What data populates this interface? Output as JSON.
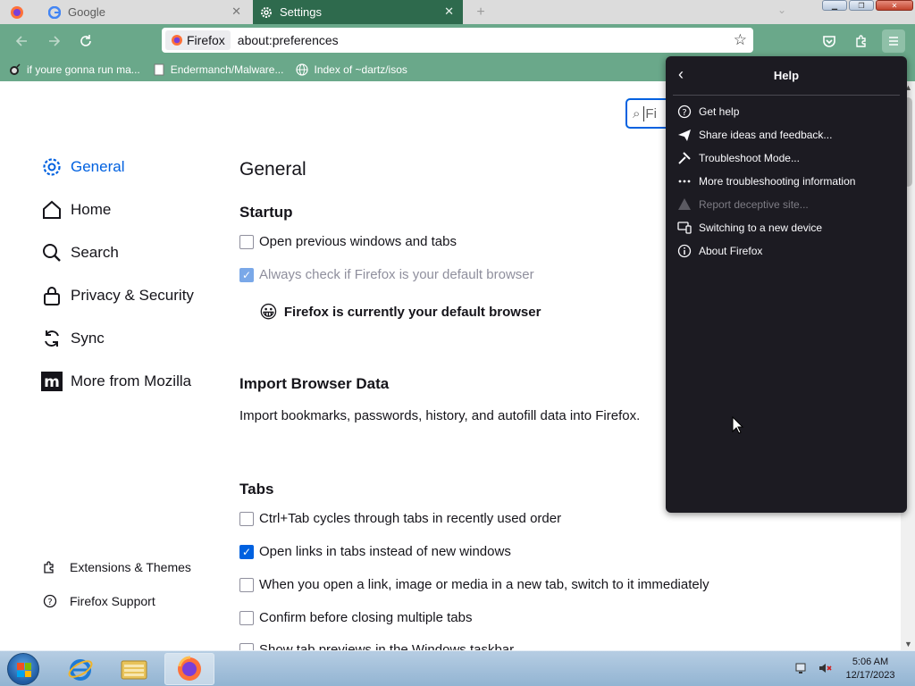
{
  "tabs": [
    {
      "label": "Google",
      "active": false
    },
    {
      "label": "Settings",
      "active": true
    }
  ],
  "urlbar": {
    "identity": "Firefox",
    "url": "about:preferences"
  },
  "bookmarks": [
    {
      "label": "if youre gonna run ma...",
      "icon": "bomb-icon"
    },
    {
      "label": "Endermanch/Malware...",
      "icon": "page-icon"
    },
    {
      "label": "Index of ~dartz/isos",
      "icon": "globe-icon"
    }
  ],
  "search": {
    "placeholder": "Fi"
  },
  "sidebar": {
    "items": [
      {
        "label": "General",
        "icon": "gear-icon",
        "active": true
      },
      {
        "label": "Home",
        "icon": "home-icon"
      },
      {
        "label": "Search",
        "icon": "search-icon"
      },
      {
        "label": "Privacy & Security",
        "icon": "lock-icon"
      },
      {
        "label": "Sync",
        "icon": "sync-icon"
      },
      {
        "label": "More from Mozilla",
        "icon": "mozilla-icon"
      }
    ],
    "footer": [
      {
        "label": "Extensions & Themes",
        "icon": "puzzle-icon"
      },
      {
        "label": "Firefox Support",
        "icon": "help-icon"
      }
    ]
  },
  "main": {
    "title": "General",
    "startup": {
      "heading": "Startup",
      "open_previous": "Open previous windows and tabs",
      "always_check": "Always check if Firefox is your default browser",
      "default_status": "Firefox is currently your default browser"
    },
    "import": {
      "heading": "Import Browser Data",
      "description": "Import bookmarks, passwords, history, and autofill data into Firefox."
    },
    "tabs_section": {
      "heading": "Tabs",
      "options": [
        {
          "label": "Ctrl+Tab cycles through tabs in recently used order",
          "checked": false
        },
        {
          "label": "Open links in tabs instead of new windows",
          "checked": true
        },
        {
          "label": "When you open a link, image or media in a new tab, switch to it immediately",
          "checked": false
        },
        {
          "label": "Confirm before closing multiple tabs",
          "checked": false
        },
        {
          "label": "Show tab previews in the Windows taskbar",
          "checked": false
        }
      ]
    }
  },
  "help_panel": {
    "title": "Help",
    "items": [
      {
        "label": "Get help",
        "icon": "question-circle-icon",
        "enabled": true
      },
      {
        "label": "Share ideas and feedback...",
        "icon": "send-icon",
        "enabled": true
      },
      {
        "label": "Troubleshoot Mode...",
        "icon": "tools-icon",
        "enabled": true
      },
      {
        "label": "More troubleshooting information",
        "icon": "more-dots-icon",
        "enabled": true
      },
      {
        "label": "Report deceptive site...",
        "icon": "warning-icon",
        "enabled": false
      },
      {
        "label": "Switching to a new device",
        "icon": "devices-icon",
        "enabled": true
      },
      {
        "label": "About Firefox",
        "icon": "info-icon",
        "enabled": true
      }
    ]
  },
  "taskbar": {
    "time": "5:06 AM",
    "date": "12/17/2023"
  },
  "colors": {
    "accent": "#0061e0",
    "chrome": "#6aa88a",
    "active_tab": "#2e6a4d",
    "panel": "#1c1b22"
  }
}
